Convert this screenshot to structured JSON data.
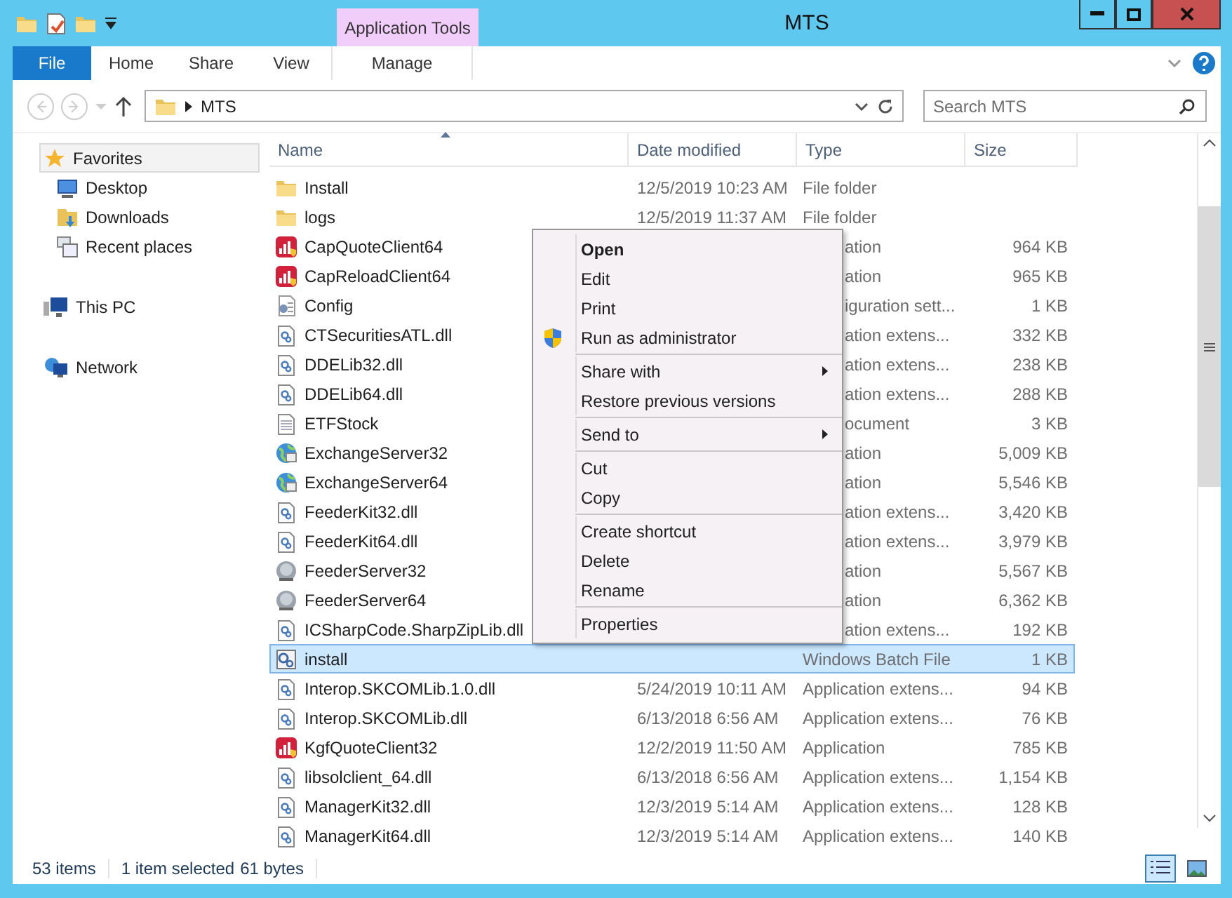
{
  "window": {
    "title": "MTS"
  },
  "ribbon": {
    "context_group": "Application Tools",
    "tabs": [
      {
        "label": "File",
        "kind": "file"
      },
      {
        "label": "Home",
        "kind": "tab"
      },
      {
        "label": "Share",
        "kind": "tab"
      },
      {
        "label": "View",
        "kind": "tab"
      },
      {
        "label": "Manage",
        "kind": "context"
      }
    ]
  },
  "address": {
    "path": "MTS"
  },
  "search": {
    "placeholder": "Search MTS"
  },
  "nav": [
    {
      "label": "Favorites",
      "kind": "favorites",
      "selected": true,
      "children": [
        {
          "label": "Desktop",
          "kind": "desktop",
          "selected": false
        },
        {
          "label": "Downloads",
          "kind": "downloads",
          "selected": false
        },
        {
          "label": "Recent places",
          "kind": "recent",
          "selected": false
        }
      ]
    },
    {
      "label": "This PC",
      "kind": "pc",
      "selected": false
    },
    {
      "label": "Network",
      "kind": "network",
      "selected": false
    }
  ],
  "table": {
    "columns": [
      "Name",
      "Date modified",
      "Type",
      "Size"
    ],
    "rows": [
      {
        "name": "Install",
        "kind": "folder",
        "date": "12/5/2019 10:23 AM",
        "type": "File folder",
        "covered": false,
        "selected": false
      },
      {
        "name": "logs",
        "kind": "folder",
        "date": "12/5/2019 11:37 AM",
        "type": "File folder",
        "covered": false,
        "selected": false
      },
      {
        "name": "CapQuoteClient64",
        "kind": "app",
        "type": "ation",
        "size": "964 KB",
        "covered": true,
        "selected": false
      },
      {
        "name": "CapReloadClient64",
        "kind": "app",
        "type": "ation",
        "size": "965 KB",
        "covered": true,
        "selected": false
      },
      {
        "name": "Config",
        "kind": "config",
        "type": "iguration sett...",
        "size": "1 KB",
        "covered": true,
        "selected": false
      },
      {
        "name": "CTSecuritiesATL.dll",
        "kind": "dll",
        "type": "ation extens...",
        "size": "332 KB",
        "covered": true,
        "selected": false
      },
      {
        "name": "DDELib32.dll",
        "kind": "dll",
        "type": "ation extens...",
        "size": "238 KB",
        "covered": true,
        "selected": false
      },
      {
        "name": "DDELib64.dll",
        "kind": "dll",
        "type": "ation extens...",
        "size": "288 KB",
        "covered": true,
        "selected": false
      },
      {
        "name": "ETFStock",
        "kind": "text",
        "type": "ocument",
        "size": "3 KB",
        "covered": true,
        "selected": false
      },
      {
        "name": "ExchangeServer32",
        "kind": "globe",
        "type": "ation",
        "size": "5,009 KB",
        "covered": true,
        "selected": false
      },
      {
        "name": "ExchangeServer64",
        "kind": "globe",
        "type": "ation",
        "size": "5,546 KB",
        "covered": true,
        "selected": false
      },
      {
        "name": "FeederKit32.dll",
        "kind": "dll",
        "type": "ation extens...",
        "size": "3,420 KB",
        "covered": true,
        "selected": false
      },
      {
        "name": "FeederKit64.dll",
        "kind": "dll",
        "type": "ation extens...",
        "size": "3,979 KB",
        "covered": true,
        "selected": false
      },
      {
        "name": "FeederServer32",
        "kind": "server",
        "type": "ation",
        "size": "5,567 KB",
        "covered": true,
        "selected": false
      },
      {
        "name": "FeederServer64",
        "kind": "server",
        "type": "ation",
        "size": "6,362 KB",
        "covered": true,
        "selected": false
      },
      {
        "name": "ICSharpCode.SharpZipLib.dll",
        "kind": "dll",
        "type": "ation extens...",
        "size": "192 KB",
        "covered": true,
        "selected": false
      },
      {
        "name": "install",
        "kind": "batch",
        "type": "Windows Batch File",
        "size": "1 KB",
        "covered": false,
        "selected": true
      },
      {
        "name": "Interop.SKCOMLib.1.0.dll",
        "kind": "dll",
        "date": "5/24/2019 10:11 AM",
        "type": "Application extens...",
        "size": "94 KB",
        "covered": false,
        "selected": false
      },
      {
        "name": "Interop.SKCOMLib.dll",
        "kind": "dll",
        "date": "6/13/2018 6:56 AM",
        "type": "Application extens...",
        "size": "76 KB",
        "covered": false,
        "selected": false
      },
      {
        "name": "KgfQuoteClient32",
        "kind": "app",
        "date": "12/2/2019 11:50 AM",
        "type": "Application",
        "size": "785 KB",
        "covered": false,
        "selected": false
      },
      {
        "name": "libsolclient_64.dll",
        "kind": "dll",
        "date": "6/13/2018 6:56 AM",
        "type": "Application extens...",
        "size": "1,154 KB",
        "covered": false,
        "selected": false
      },
      {
        "name": "ManagerKit32.dll",
        "kind": "dll",
        "date": "12/3/2019 5:14 AM",
        "type": "Application extens...",
        "size": "128 KB",
        "covered": false,
        "selected": false
      },
      {
        "name": "ManagerKit64.dll",
        "kind": "dll",
        "date": "12/3/2019 5:14 AM",
        "type": "Application extens...",
        "size": "140 KB",
        "covered": false,
        "selected": false
      }
    ]
  },
  "context_menu": [
    [
      {
        "label": "Open",
        "default": true,
        "elevated": false,
        "submenu": false
      },
      {
        "label": "Edit",
        "default": false,
        "elevated": false,
        "submenu": false
      },
      {
        "label": "Print",
        "default": false,
        "elevated": false,
        "submenu": false
      },
      {
        "label": "Run as administrator",
        "default": false,
        "elevated": true,
        "submenu": false
      }
    ],
    [
      {
        "label": "Share with",
        "default": false,
        "elevated": false,
        "submenu": true
      },
      {
        "label": "Restore previous versions",
        "default": false,
        "elevated": false,
        "submenu": false
      }
    ],
    [
      {
        "label": "Send to",
        "default": false,
        "elevated": false,
        "submenu": true
      }
    ],
    [
      {
        "label": "Cut",
        "default": false,
        "elevated": false,
        "submenu": false
      },
      {
        "label": "Copy",
        "default": false,
        "elevated": false,
        "submenu": false
      }
    ],
    [
      {
        "label": "Create shortcut",
        "default": false,
        "elevated": false,
        "submenu": false
      },
      {
        "label": "Delete",
        "default": false,
        "elevated": false,
        "submenu": false
      },
      {
        "label": "Rename",
        "default": false,
        "elevated": false,
        "submenu": false
      }
    ],
    [
      {
        "label": "Properties",
        "default": false,
        "elevated": false,
        "submenu": false
      }
    ]
  ],
  "status_bar": {
    "count": "53 items",
    "selection": "1 item selected",
    "size": "61 bytes"
  },
  "views": [
    {
      "kind": "details",
      "selected": true
    },
    {
      "kind": "large",
      "selected": false
    }
  ]
}
